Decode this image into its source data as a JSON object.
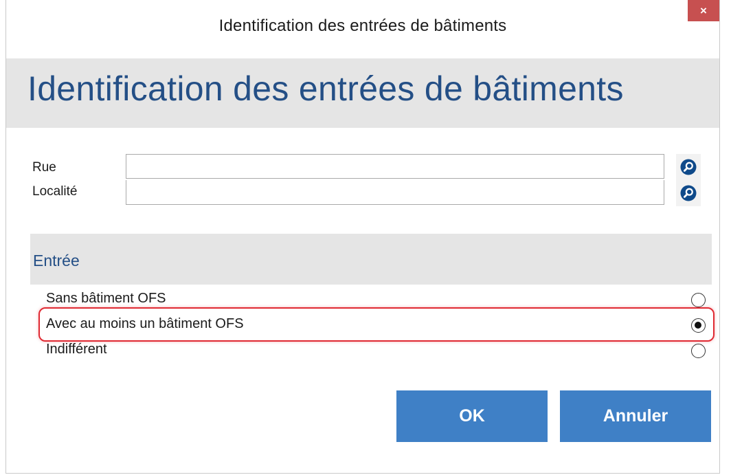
{
  "window": {
    "title": "Identification des entrées de bâtiments",
    "close_label": "×"
  },
  "banner": {
    "title": "Identification des entrées de bâtiments"
  },
  "fields": {
    "rue": {
      "label": "Rue",
      "value": ""
    },
    "localite": {
      "label": "Localité",
      "value": ""
    }
  },
  "entree": {
    "title": "Entrée",
    "options": [
      {
        "label": "Sans bâtiment OFS",
        "selected": false
      },
      {
        "label": "Avec au moins un bâtiment OFS",
        "selected": true
      },
      {
        "label": "Indifférent",
        "selected": false
      }
    ]
  },
  "buttons": {
    "ok": "OK",
    "cancel": "Annuler"
  },
  "colors": {
    "accent": "#244f86",
    "button": "#3f80c6",
    "highlight": "#e02a33",
    "close": "#c75050"
  },
  "icons": {
    "lookup": "magnifier-icon"
  }
}
